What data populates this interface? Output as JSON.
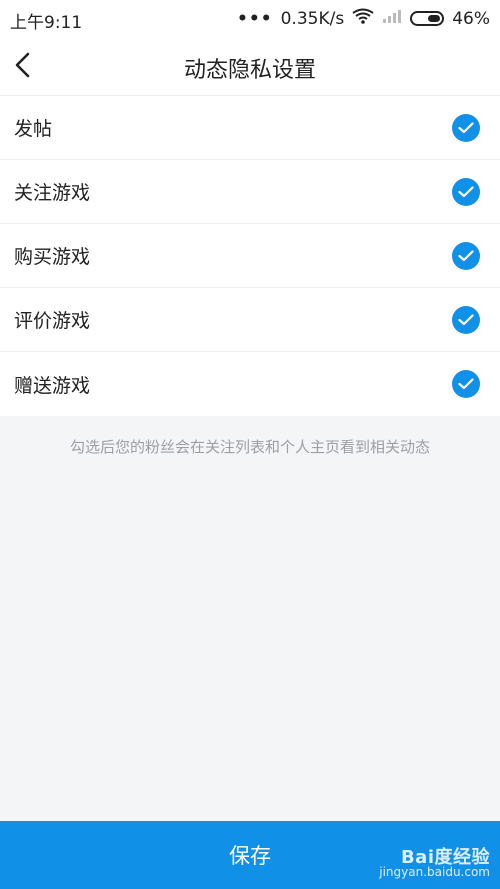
{
  "status": {
    "time": "上午9:11",
    "speed": "0.35K/s",
    "battery": "46%"
  },
  "nav": {
    "title": "动态隐私设置"
  },
  "items": [
    {
      "label": "发帖",
      "checked": true
    },
    {
      "label": "关注游戏",
      "checked": true
    },
    {
      "label": "购买游戏",
      "checked": true
    },
    {
      "label": "评价游戏",
      "checked": true
    },
    {
      "label": "赠送游戏",
      "checked": true
    }
  ],
  "hint": "勾选后您的粉丝会在关注列表和个人主页看到相关动态",
  "save_label": "保存",
  "watermark": {
    "brand": "Bai度经验",
    "url": "jingyan.baidu.com"
  },
  "colors": {
    "accent": "#1190e8",
    "background": "#f4f5f7"
  }
}
